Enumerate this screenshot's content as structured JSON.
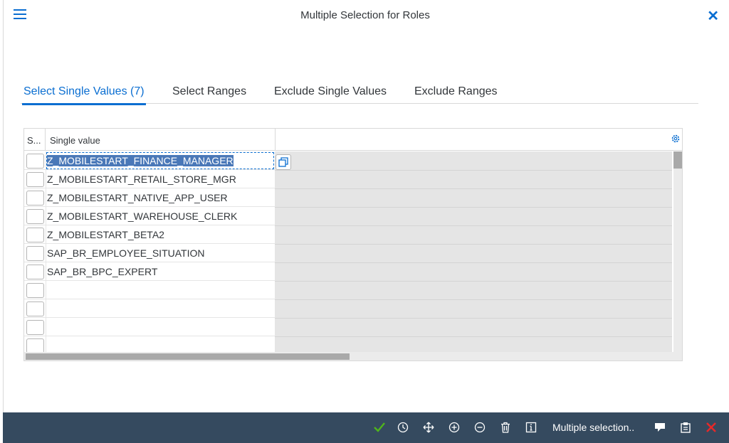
{
  "dialog": {
    "title": "Multiple Selection for Roles"
  },
  "tabs": [
    {
      "label": "Select Single Values (7)",
      "active": true
    },
    {
      "label": "Select Ranges",
      "active": false
    },
    {
      "label": "Exclude Single Values",
      "active": false
    },
    {
      "label": "Exclude Ranges",
      "active": false
    }
  ],
  "table": {
    "columns": [
      "S...",
      "Single value"
    ],
    "rows": [
      "Z_MOBILESTART_FINANCE_MANAGER",
      "Z_MOBILESTART_RETAIL_STORE_MGR",
      "Z_MOBILESTART_NATIVE_APP_USER",
      "Z_MOBILESTART_WAREHOUSE_CLERK",
      "Z_MOBILESTART_BETA2",
      "SAP_BR_EMPLOYEE_SITUATION",
      "SAP_BR_BPC_EXPERT",
      "",
      "",
      "",
      ""
    ],
    "selected_row": 0
  },
  "footer": {
    "multiple_selection_label": "Multiple selection..",
    "icons": [
      "checkmark-icon",
      "history-icon",
      "move-icon",
      "add-icon",
      "remove-icon",
      "delete-icon",
      "info-icon",
      "upload-icon",
      "clipboard-icon",
      "cancel-icon"
    ]
  },
  "colors": {
    "accent": "#0a6ed1",
    "footer_bg": "#354a5f",
    "confirm": "#4fb41c",
    "cancel": "#e52929"
  }
}
